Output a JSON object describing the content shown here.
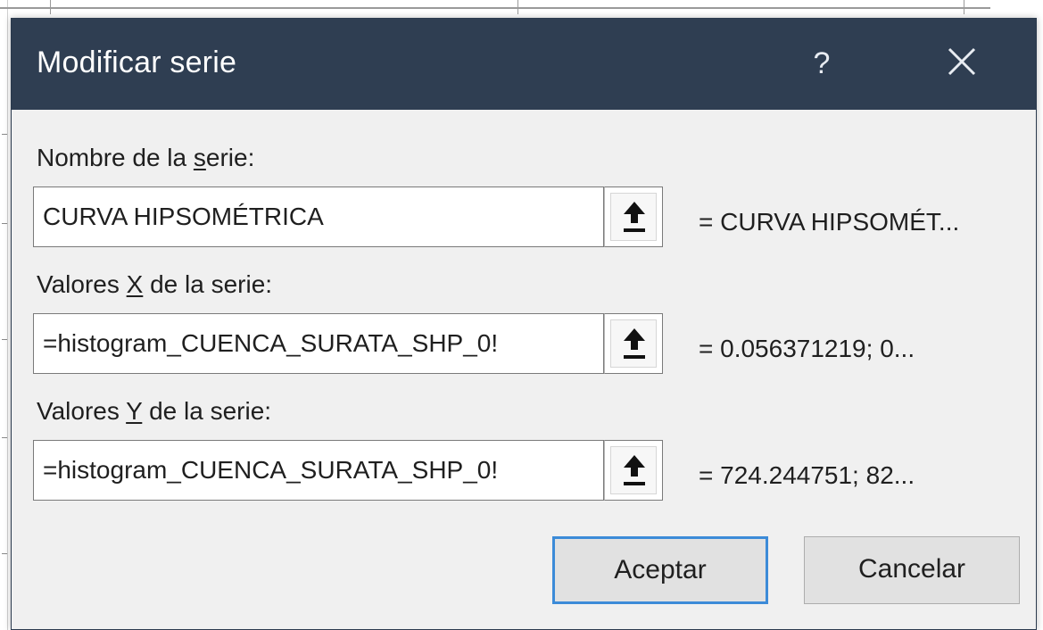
{
  "dialog": {
    "title": "Modificar serie",
    "help_label": "?",
    "close_icon": "close-icon"
  },
  "series_name": {
    "label_before": "Nombre de la ",
    "label_accel": "s",
    "label_after": "erie:",
    "value": "CURVA HIPSOMÉTRICA",
    "preview": "= CURVA HIPSOMÉT..."
  },
  "x_values": {
    "label_before": "Valores ",
    "label_accel": "X",
    "label_after": " de la serie:",
    "value": "=histogram_CUENCA_SURATA_SHP_0!",
    "preview": "= 0.056371219; 0..."
  },
  "y_values": {
    "label_before": "Valores ",
    "label_accel": "Y",
    "label_after": " de la serie:",
    "value": "=histogram_CUENCA_SURATA_SHP_0!",
    "preview": "= 724.244751; 82..."
  },
  "buttons": {
    "ok": "Aceptar",
    "cancel": "Cancelar"
  },
  "colors": {
    "titlebar": "#2f3e52",
    "dialog_bg": "#f0f0f0",
    "default_button_border": "#3c8bd8"
  },
  "icons": {
    "collapse": "collapse-dialog-icon"
  }
}
